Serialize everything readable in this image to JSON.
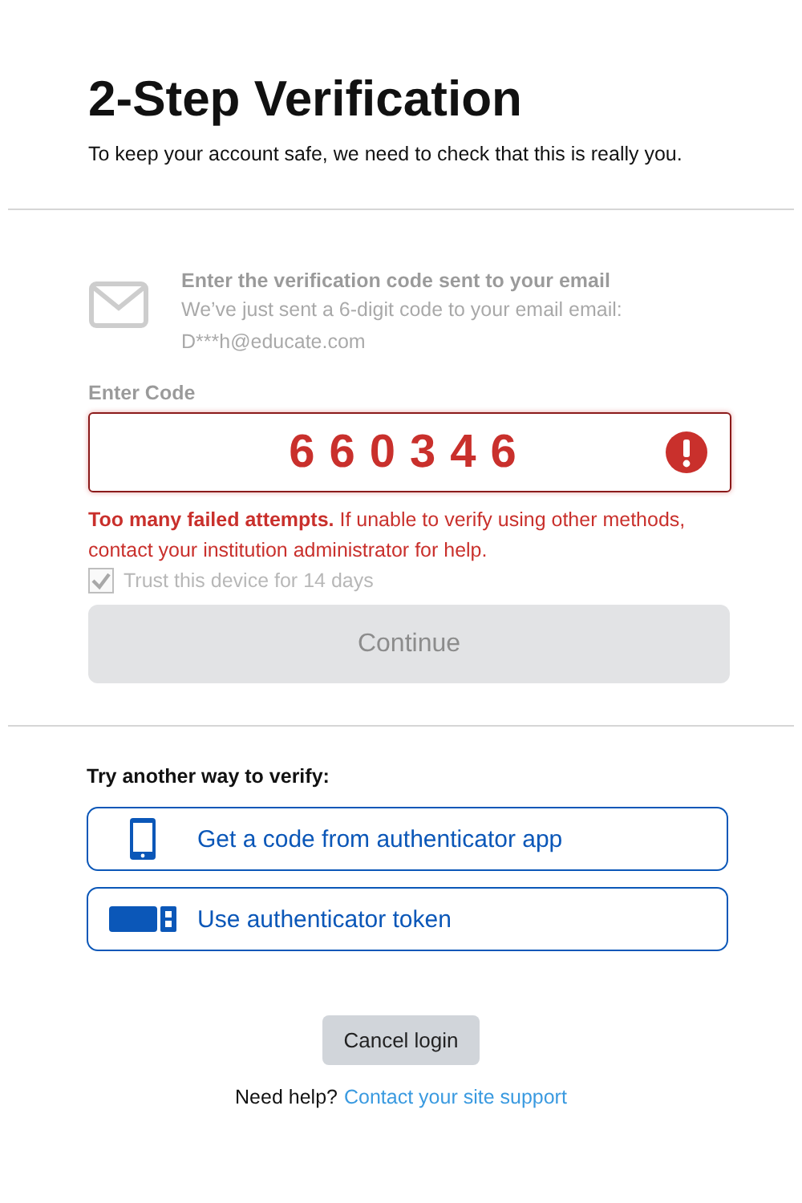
{
  "title": "2-Step Verification",
  "subtitle": "To keep your account safe, we need to check that this is really you.",
  "email_step": {
    "disabled": true,
    "heading": "Enter the verification code sent to your email",
    "message": "We’ve just sent a 6-digit code to your email email: D***h@educate.com"
  },
  "code_field": {
    "label": "Enter Code",
    "value": "660346",
    "error": true
  },
  "error_message": "**Too many failed attempts.** If unable to verify using other methods, contact your institution administrator for help.",
  "trust_device": {
    "label": "Trust this device for 14 days",
    "checked": true,
    "disabled": true
  },
  "continue_button": {
    "label": "Continue",
    "disabled": true
  },
  "alternatives_heading": "Try another way to verify:",
  "alternatives": [
    {
      "kind": "phone",
      "label": "Get a code from authenticator app"
    },
    {
      "kind": "token",
      "label": "Use authenticator token"
    }
  ],
  "cancel_button": "Cancel login",
  "help": {
    "text": "Need help?",
    "link": "Contact your site support"
  }
}
